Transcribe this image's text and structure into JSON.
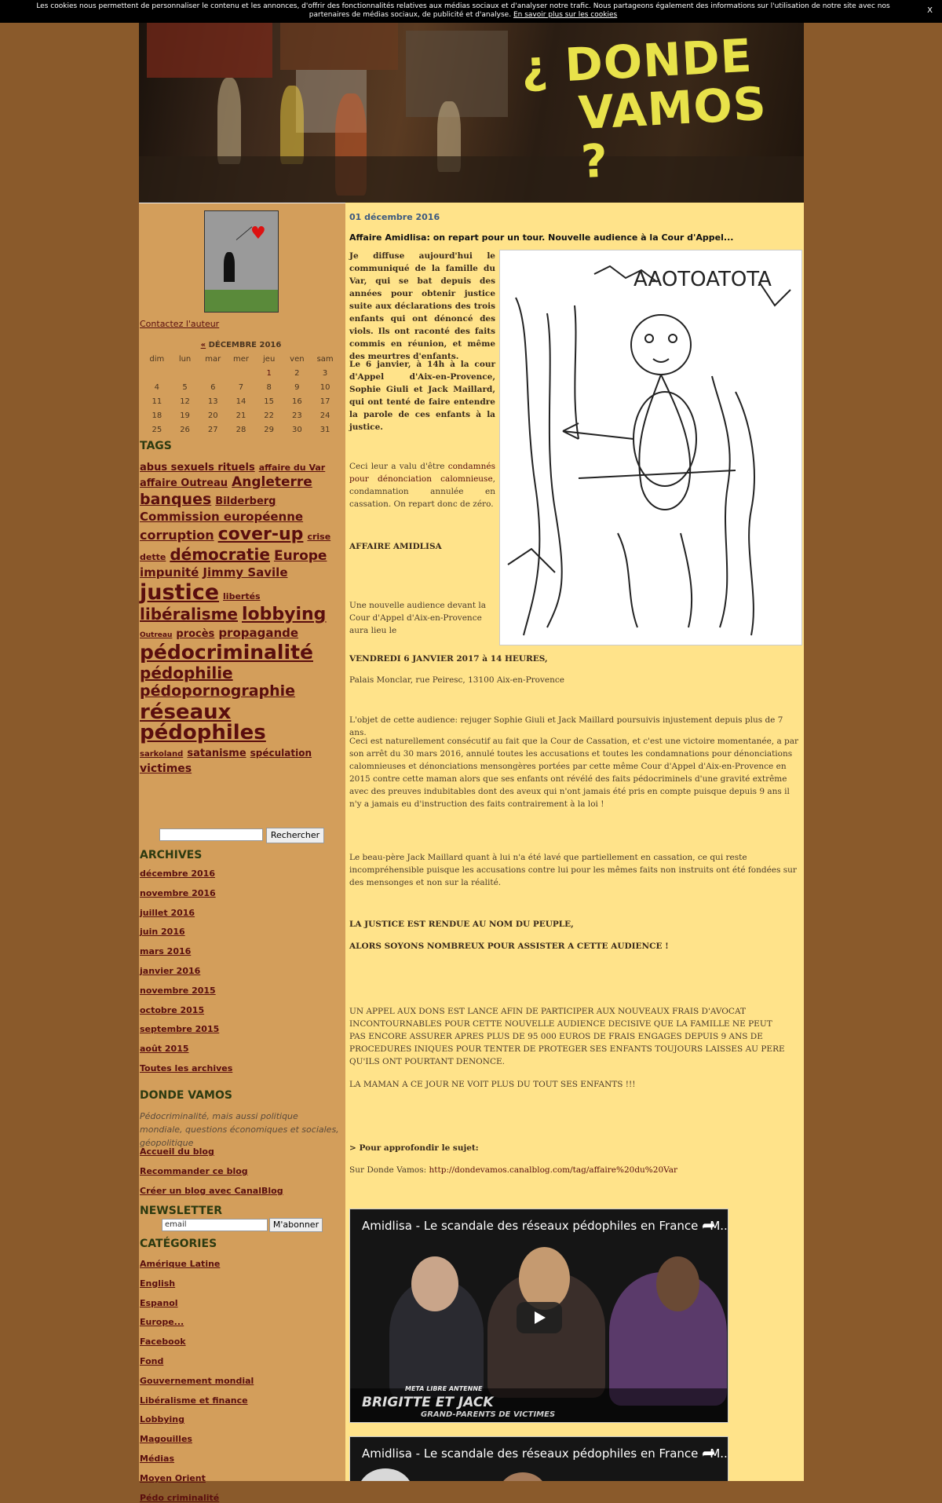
{
  "cookie": {
    "text": "Les cookies nous permettent de personnaliser le contenu et les annonces, d'offrir des fonctionnalités relatives aux médias sociaux et d'analyser notre trafic. Nous partageons également des informations sur l'utilisation de notre site avec nos partenaires de médias sociaux, de publicité et d'analyse.",
    "link": "En savoir plus sur les cookies",
    "close": "X"
  },
  "banner": {
    "title_line1": "¿ DONDE",
    "title_line2": "VAMOS ?"
  },
  "sidebar": {
    "contact": "Contactez l'auteur",
    "calendar": {
      "prev": "«",
      "month": "DÉCEMBRE 2016",
      "days": [
        "dim",
        "lun",
        "mar",
        "mer",
        "jeu",
        "ven",
        "sam"
      ],
      "weeks": [
        [
          "",
          "",
          "",
          "",
          "1",
          "2",
          "3"
        ],
        [
          "4",
          "5",
          "6",
          "7",
          "8",
          "9",
          "10"
        ],
        [
          "11",
          "12",
          "13",
          "14",
          "15",
          "16",
          "17"
        ],
        [
          "18",
          "19",
          "20",
          "21",
          "22",
          "23",
          "24"
        ],
        [
          "25",
          "26",
          "27",
          "28",
          "29",
          "30",
          "31"
        ]
      ]
    },
    "tags_title": "TAGS",
    "tags": [
      {
        "label": "abus sexuels rituels",
        "size": 13
      },
      {
        "label": "affaire du Var",
        "size": 11
      },
      {
        "label": "affaire Outreau",
        "size": 13
      },
      {
        "label": "Angleterre",
        "size": 17
      },
      {
        "label": "banques",
        "size": 19
      },
      {
        "label": "Bilderberg",
        "size": 13
      },
      {
        "label": "Commission européenne",
        "size": 15
      },
      {
        "label": "corruption",
        "size": 16
      },
      {
        "label": "cover-up",
        "size": 22
      },
      {
        "label": "crise",
        "size": 11
      },
      {
        "label": "dette",
        "size": 11
      },
      {
        "label": "démocratie",
        "size": 20
      },
      {
        "label": "Europe",
        "size": 17
      },
      {
        "label": "impunité",
        "size": 15
      },
      {
        "label": "Jimmy Savile",
        "size": 15
      },
      {
        "label": "justice",
        "size": 27
      },
      {
        "label": "libertés",
        "size": 11
      },
      {
        "label": "libéralisme",
        "size": 20
      },
      {
        "label": "lobbying",
        "size": 22
      },
      {
        "label": "Outreau",
        "size": 9
      },
      {
        "label": "procès",
        "size": 13
      },
      {
        "label": "propagande",
        "size": 15
      },
      {
        "label": "pédocriminalité",
        "size": 25
      },
      {
        "label": "pédophilie",
        "size": 20
      },
      {
        "label": "pédopornographie",
        "size": 19
      },
      {
        "label": "réseaux pédophiles",
        "size": 26
      },
      {
        "label": "sarkoland",
        "size": 10
      },
      {
        "label": "satanisme",
        "size": 13
      },
      {
        "label": "spéculation",
        "size": 12
      },
      {
        "label": "victimes",
        "size": 14
      }
    ],
    "search_button": "Rechercher",
    "archives_title": "ARCHIVES",
    "archives": [
      "décembre 2016",
      "novembre 2016",
      "juillet 2016",
      "juin 2016",
      "mars 2016",
      "janvier 2016",
      "novembre 2015",
      "octobre 2015",
      "septembre 2015",
      "août 2015",
      "Toutes les archives"
    ],
    "donde_title": "DONDE VAMOS",
    "description": "Pédocriminalité, mais aussi politique mondiale, questions économiques et sociales, géopolitique",
    "blog_links": [
      "Accueil du blog",
      "Recommander ce blog",
      "Créer un blog avec CanalBlog"
    ],
    "newsletter_title": "NEWSLETTER",
    "newsletter_value": "email",
    "newsletter_button": "M'abonner",
    "categories_title": "CATÉGORIES",
    "categories": [
      "Amérique Latine",
      "English",
      "Espanol",
      "Europe...",
      "Facebook",
      "Fond",
      "Gouvernement mondial",
      "Libéralisme et finance",
      "Lobbying",
      "Magouilles",
      "Médias",
      "Moyen Orient",
      "Pédo criminalité"
    ]
  },
  "post": {
    "date": "01 décembre 2016",
    "title": "Affaire Amidlisa: on repart pour un tour. Nouvelle audience à la Cour d'Appel...",
    "drawing_text": "AAOTOATOTA",
    "p1": "Je diffuse aujourd'hui le communiqué de la famille du Var, qui se bat depuis des années pour obtenir justice suite aux déclarations des trois enfants qui ont dénoncé des viols. Ils ont raconté des faits commis en réunion, et même des meurtres d'enfants.",
    "p2": "Le 6 janvier, à 14h à la cour d'Appel d'Aix-en-Provence, Sophie Giuli et Jack Maillard, qui ont tenté de faire entendre la parole de ces enfants à la justice.",
    "p3_before": "Ceci leur a valu d'être ",
    "p3_link": "condamnés pour dénonciation calomnieuse",
    "p3_after": ", condamnation annulée en cassation. On repart donc de zéro.",
    "affaire": "AFFAIRE AMIDLISA",
    "p4": "Une nouvelle audience devant la Cour d'Appel d'Aix-en-Provence aura lieu le",
    "p5": "VENDREDI 6 JANVIER 2017 à 14 HEURES,",
    "p6": "Palais Monclar, rue Peiresc, 13100 Aix-en-Provence",
    "p7": "L'objet de cette audience: rejuger Sophie Giuli et Jack Maillard poursuivis injustement depuis plus de 7 ans.",
    "p8": "Ceci est naturellement consécutif au fait que la Cour de Cassation, et c'est une victoire momentanée, a par son arrêt du 30 mars 2016, annulé toutes les accusations et toutes les condamnations pour dénonciations calomnieuses et dénonciations mensongères portées par cette même Cour d'Appel d'Aix-en-Provence en 2015 contre cette maman alors que ses enfants ont révélé des faits pédocriminels d'une gravité extrême avec des preuves indubitables dont des aveux qui n'ont jamais été pris en compte puisque depuis 9 ans il n'y a jamais eu d'instruction des faits contrairement à la loi !",
    "p9": "Le beau-père Jack Maillard quant à lui n'a été lavé que partiellement en cassation, ce qui reste incompréhensible puisque les accusations contre lui pour les mêmes faits non instruits ont été fondées sur des mensonges et non sur la réalité.",
    "p10": "LA JUSTICE EST RENDUE AU NOM DU PEUPLE,",
    "p11": "ALORS SOYONS NOMBREUX POUR ASSISTER A CETTE AUDIENCE !",
    "p12": "UN APPEL AUX DONS EST LANCE AFIN DE PARTICIPER AUX NOUVEAUX FRAIS D'AVOCAT INCONTOURNABLES POUR CETTE NOUVELLE AUDIENCE DECISIVE QUE LA FAMILLE NE PEUT PAS ENCORE ASSURER APRES PLUS DE 95 000 EUROS DE FRAIS ENGAGES DEPUIS 9 ANS DE PROCEDURES INIQUES POUR TENTER DE PROTEGER SES ENFANTS TOUJOURS LAISSES AU PERE QU'ILS ONT POURTANT DENONCE.",
    "p13": "LA MAMAN A CE JOUR NE VOIT PLUS DU TOUT SES ENFANTS !!!",
    "p14": "> Pour approfondir le sujet:",
    "p15_before": "Sur Donde Vamos: ",
    "p15_link": "http://dondevamos.canalblog.com/tag/affaire%20du%20Var",
    "video1_title": "Amidlisa - Le scandale des réseaux pédophiles en France - M...",
    "video1_caption1": "BRIGITTE ET JACK",
    "video1_caption2": "GRAND-PARENTS DE VICTIMES",
    "video1_tag": "META LIBRE ANTENNE",
    "video2_title": "Amidlisa - Le scandale des réseaux pédophiles en France - M..."
  }
}
